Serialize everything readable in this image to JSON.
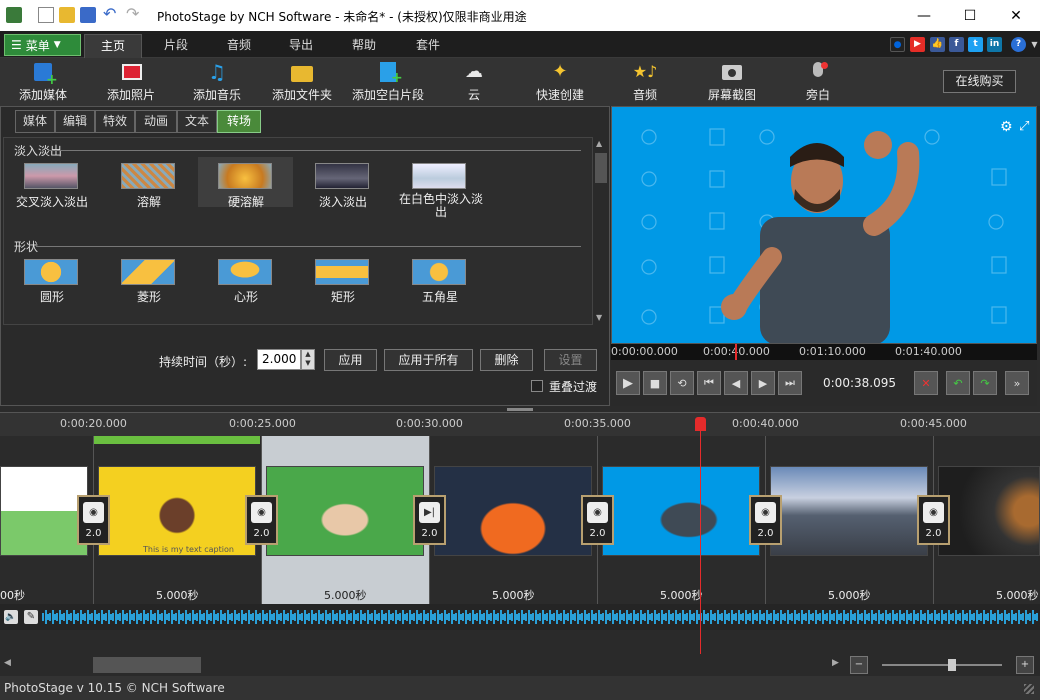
{
  "window": {
    "title": "PhotoStage by NCH Software - 未命名* - (未授权)仅限非商业用途"
  },
  "menu_button": "菜单",
  "top_tabs": [
    "主页",
    "片段",
    "音频",
    "导出",
    "帮助",
    "套件"
  ],
  "social_icons": [
    "flickr-icon",
    "youtube-icon",
    "like-icon",
    "facebook-icon",
    "twitter-icon",
    "linkedin-icon",
    "help-icon"
  ],
  "toolbar": {
    "items": [
      "添加媒体",
      "添加照片",
      "添加音乐",
      "添加文件夹",
      "添加空白片段",
      "云",
      "快速创建",
      "音频",
      "屏幕截图",
      "旁白"
    ],
    "buy_online": "在线购买"
  },
  "sub_tabs": [
    "媒体",
    "编辑",
    "特效",
    "动画",
    "文本",
    "转场"
  ],
  "gallery": {
    "section1": "淡入淡出",
    "section1_items": [
      "交叉淡入淡出",
      "溶解",
      "硬溶解",
      "淡入淡出",
      "在白色中淡入淡出"
    ],
    "section2": "形状",
    "section2_items": [
      "圆形",
      "菱形",
      "心形",
      "矩形",
      "五角星"
    ]
  },
  "controls": {
    "duration_label": "持续时间（秒）:",
    "duration_value": "2.000",
    "apply": "应用",
    "apply_all": "应用于所有",
    "delete": "删除",
    "settings": "设置",
    "overlap_label": "重叠过渡"
  },
  "preview": {
    "ruler_ticks": [
      "0:00:00.000",
      "0:00:40.000",
      "0:01:10.000",
      "0:01:40.000"
    ],
    "current_time": "0:00:38.095"
  },
  "timeline": {
    "ruler_ticks": [
      "0:00:20.000",
      "0:00:25.000",
      "0:00:30.000",
      "0:00:35.000",
      "0:00:40.000",
      "0:00:45.000"
    ],
    "clip_durations": [
      "5.000秒",
      "5.000秒",
      "5.000秒",
      "5.000秒",
      "5.000秒",
      "5.000秒"
    ],
    "first_clip_duration_tail": "00秒",
    "transition_values": [
      "2.0",
      "2.0",
      "2.0",
      "2.0",
      "2.0",
      "2.0"
    ],
    "clip_caption": "This is my text caption"
  },
  "status": {
    "text": "PhotoStage v 10.15 © NCH Software"
  },
  "colors": {
    "accent_green": "#2e8b3a",
    "preview_bg": "#0099e6",
    "playhead": "#e52b2b",
    "waveform": "#2aa0d8"
  }
}
